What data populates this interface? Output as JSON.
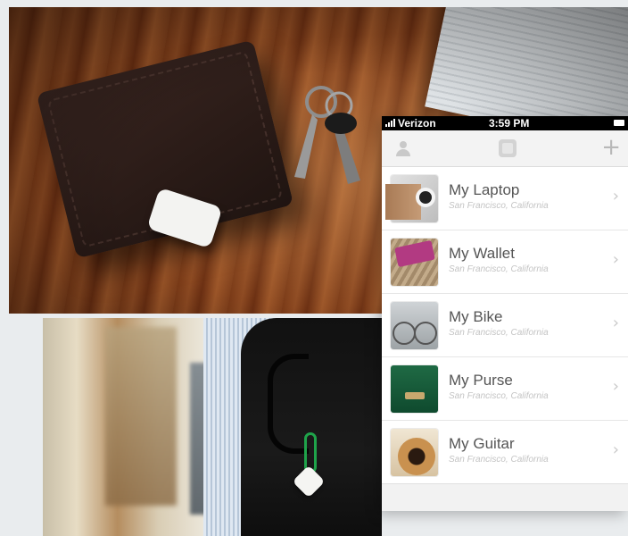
{
  "status_bar": {
    "carrier": "Verizon",
    "time": "3:59 PM"
  },
  "nav": {
    "profile_icon": "person-icon",
    "logo_icon": "tile-logo-icon",
    "add_label": "+"
  },
  "items": [
    {
      "title": "My Laptop",
      "location": "San Francisco, California",
      "thumb": "laptop"
    },
    {
      "title": "My Wallet",
      "location": "San Francisco, California",
      "thumb": "wallet"
    },
    {
      "title": "My Bike",
      "location": "San Francisco, California",
      "thumb": "bike"
    },
    {
      "title": "My Purse",
      "location": "San Francisco, California",
      "thumb": "purse"
    },
    {
      "title": "My Guitar",
      "location": "San Francisco, California",
      "thumb": "guitar"
    }
  ],
  "chevron": "›",
  "colors": {
    "title_text": "#555555",
    "subtitle_text": "#c4c4c4",
    "nav_bg": "#f3f3f3",
    "purse_green": "#1f6a44"
  }
}
